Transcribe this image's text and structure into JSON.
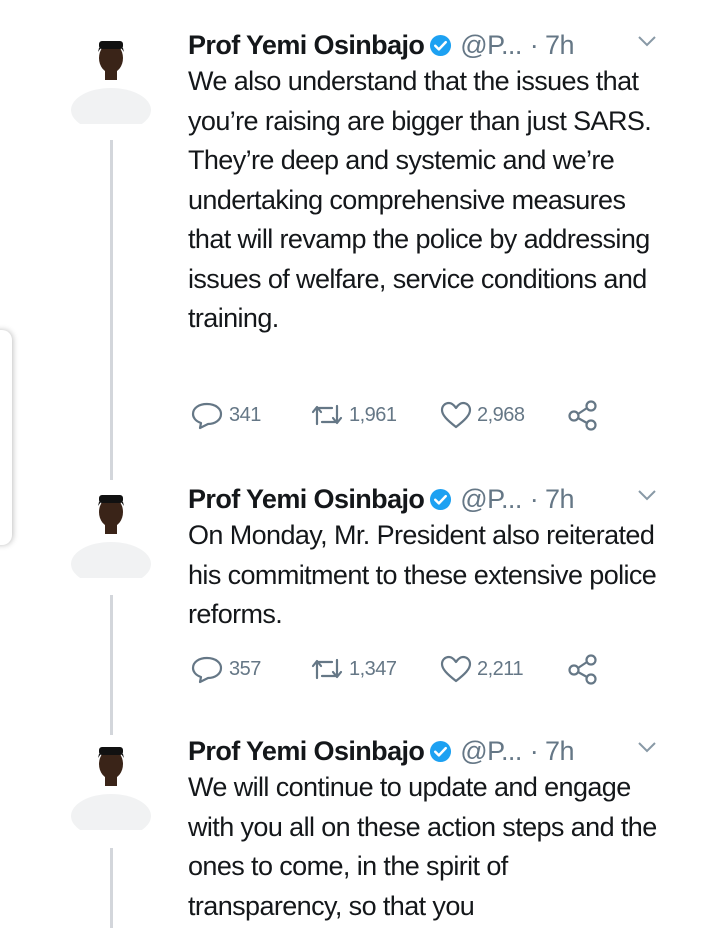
{
  "tweets": [
    {
      "author": "Prof Yemi Osinbajo",
      "handle": "@P...",
      "time": "· 7h",
      "text": "We also understand that the issues that you’re raising are bigger than just SARS. They’re deep and systemic and we’re undertaking comprehensive measures that will revamp the police by addressing issues of welfare, service conditions and training.",
      "replies": "341",
      "retweets": "1,961",
      "likes": "2,968"
    },
    {
      "author": "Prof Yemi Osinbajo",
      "handle": "@P...",
      "time": "· 7h",
      "text": "On Monday, Mr. President also reiterated his commitment to these extensive police reforms.",
      "replies": "357",
      "retweets": "1,347",
      "likes": "2,211"
    },
    {
      "author": "Prof Yemi Osinbajo",
      "handle": "@P...",
      "time": "· 7h",
      "text": "We will continue to update and engage with you all on these action steps and the ones to come, in the spirit of transparency, so that you"
    }
  ],
  "icons": {
    "verified": "verified-badge-icon",
    "menu": "chevron-down-icon",
    "reply": "reply-icon",
    "retweet": "retweet-icon",
    "like": "heart-icon",
    "share": "share-icon"
  },
  "colors": {
    "text": "#14171a",
    "muted": "#657786",
    "verified": "#1da1f2",
    "thread_line": "#d3d6db"
  }
}
